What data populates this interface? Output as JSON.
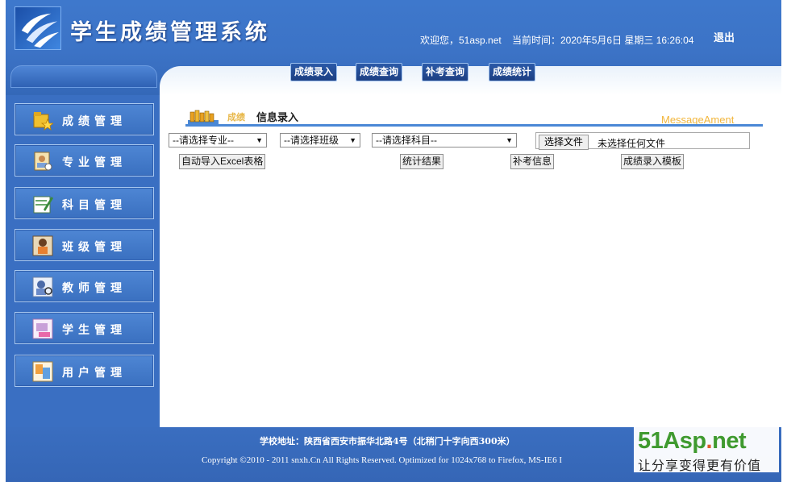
{
  "header": {
    "title": "学生成绩管理系统",
    "welcome": "欢迎您，51asp.net",
    "current_time": "当前时间：2020年5月6日 星期三 16:26:04",
    "logout_label": "退出"
  },
  "topnav": [
    {
      "label": "成绩录入"
    },
    {
      "label": "成绩查询"
    },
    {
      "label": "补考查询"
    },
    {
      "label": "成绩统计"
    }
  ],
  "sidebar": {
    "items": [
      {
        "label": "成绩管理",
        "icon": "folder-star-icon"
      },
      {
        "label": "专业管理",
        "icon": "user-badge-icon"
      },
      {
        "label": "科目管理",
        "icon": "edit-note-icon"
      },
      {
        "label": "班级管理",
        "icon": "classroom-icon"
      },
      {
        "label": "教师管理",
        "icon": "teacher-icon"
      },
      {
        "label": "学生管理",
        "icon": "student-icon"
      },
      {
        "label": "用户管理",
        "icon": "users-icon"
      }
    ]
  },
  "content": {
    "header_a": "成绩",
    "header_b": "信息录入",
    "header_en": "MessageAment",
    "selects": {
      "major": "--请选择专业--",
      "class": "--请选择班级",
      "subject": "--请选择科目--"
    },
    "file": {
      "button": "选择文件",
      "status": "未选择任何文件"
    },
    "buttons": {
      "import_excel": "自动导入Excel表格",
      "stats": "统计结果",
      "makeup": "补考信息",
      "template": "成绩录入模板"
    }
  },
  "footer": {
    "address": "学校地址：陕西省西安市振华北路4号（北稍门十字向西300米）",
    "copyright": "Copyright ©2010 - 2011 snxh.Cn All Rights Reserved. Optimized for 1024x768 to Firefox, MS-IE6 I"
  },
  "watermark": {
    "logo_main": "51Asp",
    "logo_dot": ".",
    "logo_tail": "net",
    "slogan": "让分享变得更有价值"
  }
}
